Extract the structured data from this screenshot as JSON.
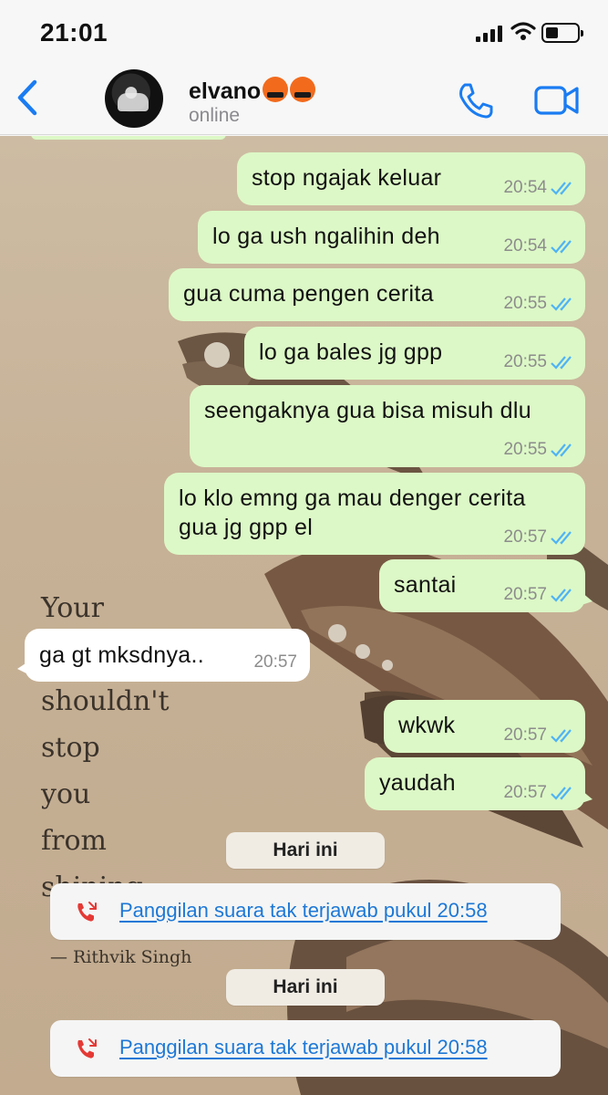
{
  "status_bar": {
    "time": "21:01"
  },
  "header": {
    "back_icon": "chevron-left-icon",
    "contact_name": "elvano",
    "contact_emojis": [
      "enraged-face-emoji",
      "enraged-face-emoji"
    ],
    "contact_status": "online",
    "call_icon": "phone-icon",
    "video_icon": "video-camera-icon"
  },
  "wallpaper": {
    "quote_lines": [
      "Your",
      "",
      "shouldn't",
      "stop",
      "you",
      "from",
      "shining"
    ],
    "author": "— Rithvik Singh"
  },
  "messages": [
    {
      "direction": "out",
      "text": "stop ngajak keluar",
      "time": "20:54",
      "status": "read"
    },
    {
      "direction": "out",
      "text": "lo ga ush ngalihin deh",
      "time": "20:54",
      "status": "read"
    },
    {
      "direction": "out",
      "text": "gua cuma pengen cerita",
      "time": "20:55",
      "status": "read"
    },
    {
      "direction": "out",
      "text": "lo ga bales jg gpp",
      "time": "20:55",
      "status": "read"
    },
    {
      "direction": "out",
      "text": "seengaknya gua bisa misuh dlu",
      "time": "20:55",
      "status": "read"
    },
    {
      "direction": "out",
      "text_line1": "lo klo emng ga mau denger cerita",
      "text_line2": "gua jg gpp el",
      "time": "20:57",
      "status": "read"
    },
    {
      "direction": "out",
      "text": "santai",
      "time": "20:57",
      "status": "read"
    },
    {
      "direction": "in",
      "text": "ga gt mksdnya..",
      "time": "20:57"
    },
    {
      "direction": "out",
      "text": "wkwk",
      "time": "20:57",
      "status": "read"
    },
    {
      "direction": "out",
      "text": "yaudah",
      "time": "20:57",
      "status": "read"
    }
  ],
  "events": [
    {
      "date_label": "Hari ini",
      "missed_call_text": "Panggilan suara tak terjawab pukul 20:58",
      "icon": "missed-call-icon"
    },
    {
      "date_label": "Hari ini",
      "missed_call_text": "Panggilan suara tak terjawab pukul 20:58",
      "icon": "missed-call-icon"
    }
  ],
  "colors": {
    "outgoing_bubble": "#dcf8c6",
    "incoming_bubble": "#ffffff",
    "accent_blue": "#1d78d6",
    "read_ticks": "#4fb3f6",
    "missed_call_red": "#e53935"
  }
}
